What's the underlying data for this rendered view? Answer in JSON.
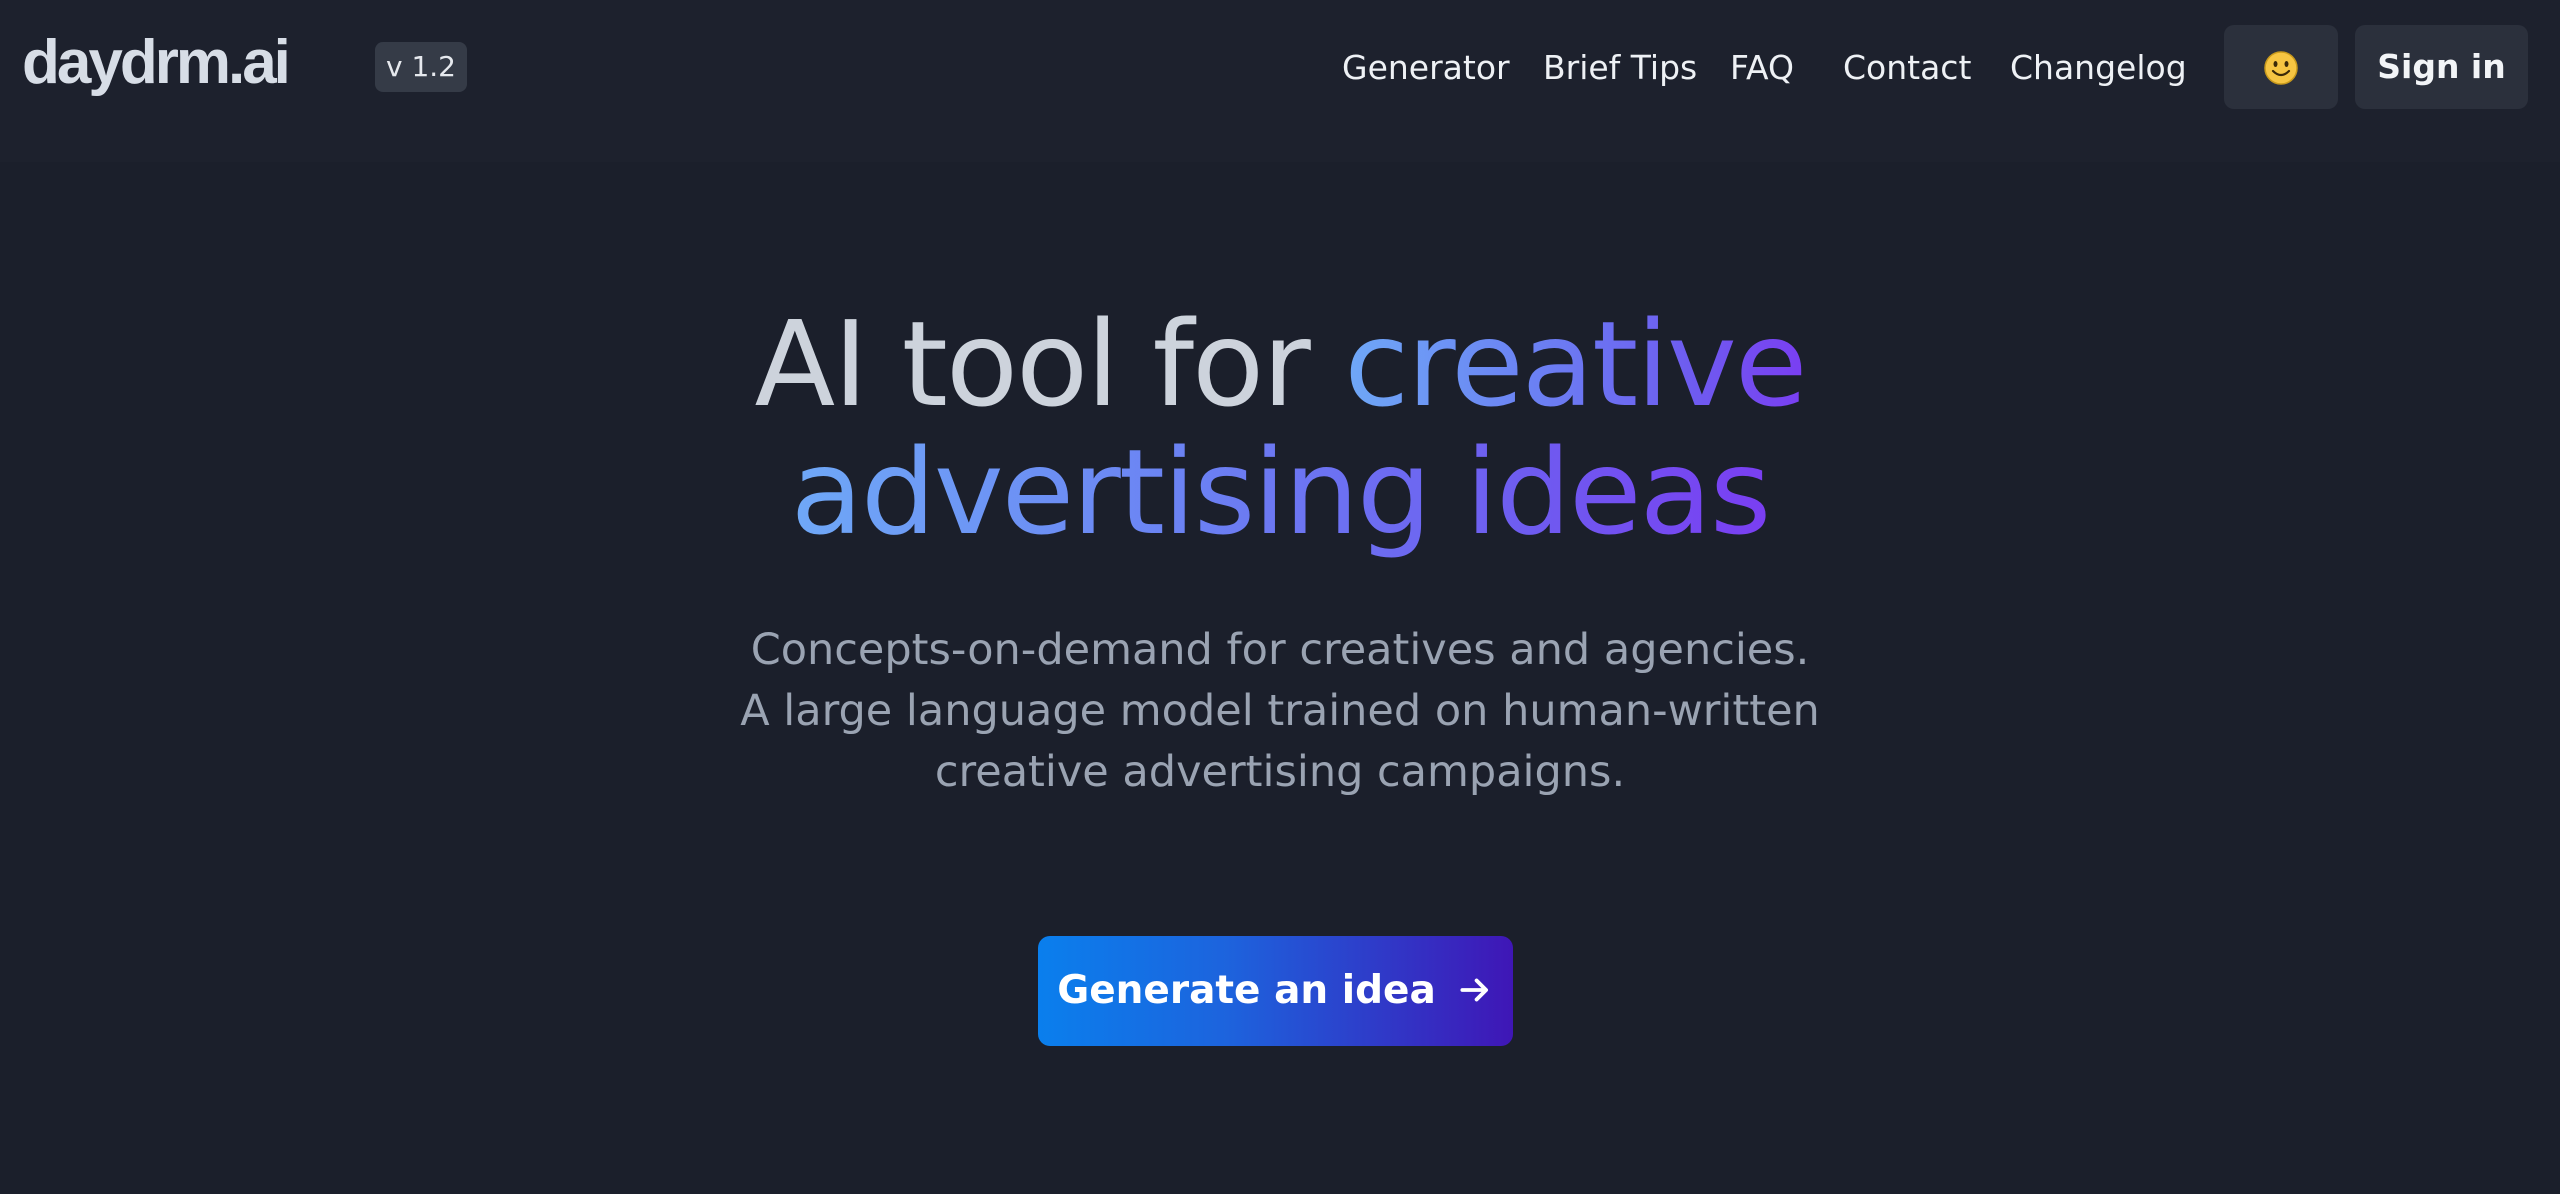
{
  "header": {
    "logo": "daydrm.ai",
    "version": "v 1.2",
    "nav": [
      {
        "label": "Generator"
      },
      {
        "label": "Brief Tips"
      },
      {
        "label": "FAQ"
      },
      {
        "label": "Contact"
      },
      {
        "label": "Changelog"
      }
    ],
    "theme_icon": "smiley-icon",
    "sign_in_label": "Sign in"
  },
  "hero": {
    "title_plain": "AI tool for ",
    "title_gradient_1": "creative",
    "title_gradient_2": "advertising ideas",
    "subtitle": "Concepts-on-demand for creatives and agencies. A large language model trained on human-written creative advertising campaigns.",
    "cta_label": "Generate an idea",
    "cta_icon": "arrow-right-icon"
  },
  "colors": {
    "background": "#1b1f2b",
    "header_background": "#1d212d",
    "gradient_start": "#6fa8f7",
    "gradient_end": "#7a3ef2",
    "cta_start": "#0a7fed",
    "cta_end": "#3f16b6"
  }
}
